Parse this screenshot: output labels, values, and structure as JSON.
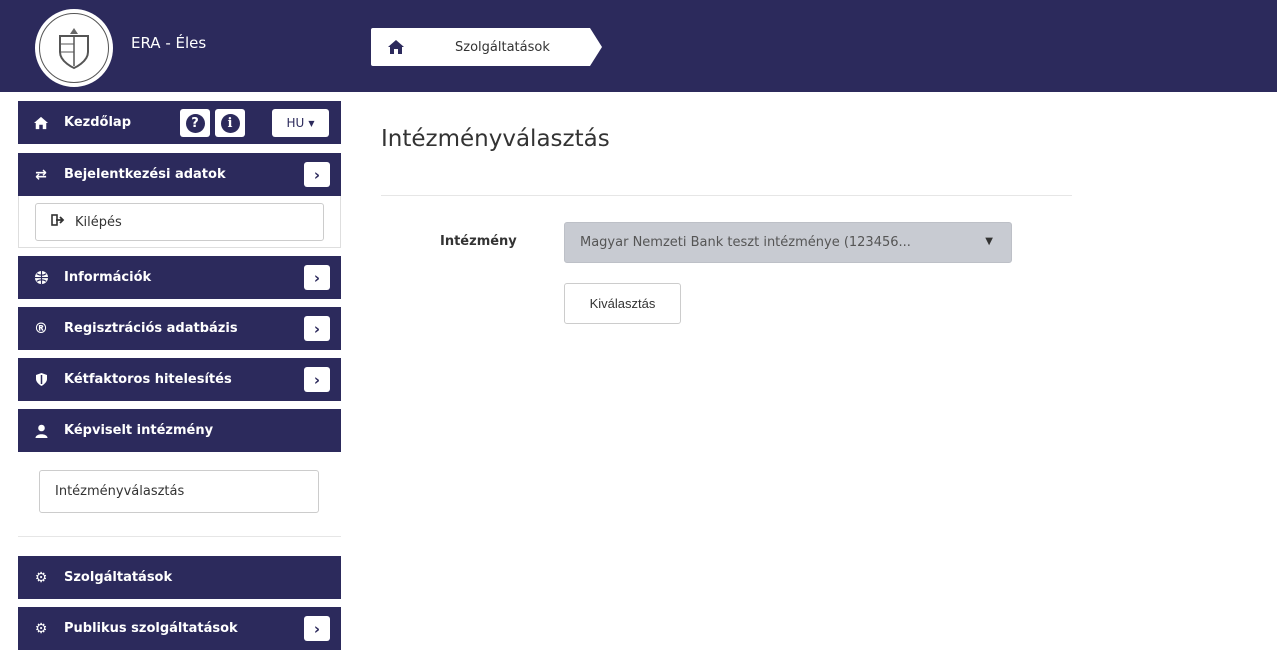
{
  "header": {
    "app_title": "ERA - Éles"
  },
  "breadcrumb": {
    "home_icon": "home-icon",
    "current": "Szolgáltatások"
  },
  "sidebar": {
    "home": {
      "label": "Kezdőlap",
      "help_icon": "question-circle-icon",
      "info_icon": "info-circle-icon",
      "lang": "HU"
    },
    "items": [
      {
        "label": "Bejelentkezési adatok",
        "icon": "exchange-icon"
      },
      {
        "label": "Információk",
        "icon": "globe-icon"
      },
      {
        "label": "Regisztrációs adatbázis",
        "icon": "registered-icon"
      },
      {
        "label": "Kétfaktoros hitelesítés",
        "icon": "shield-icon"
      },
      {
        "label": "Képviselt intézmény",
        "icon": "user-icon"
      },
      {
        "label": "Szolgáltatások",
        "icon": "cog-icon"
      },
      {
        "label": "Publikus szolgáltatások",
        "icon": "cog-icon"
      }
    ],
    "logout_label": "Kilépés",
    "institution_select_label": "Intézményválasztás"
  },
  "main": {
    "title": "Intézményválasztás",
    "field_label": "Intézmény",
    "select_value": "Magyar Nemzeti Bank teszt intézménye (123456...",
    "submit_label": "Kiválasztás"
  },
  "colors": {
    "brand": "#2c2a5c"
  }
}
